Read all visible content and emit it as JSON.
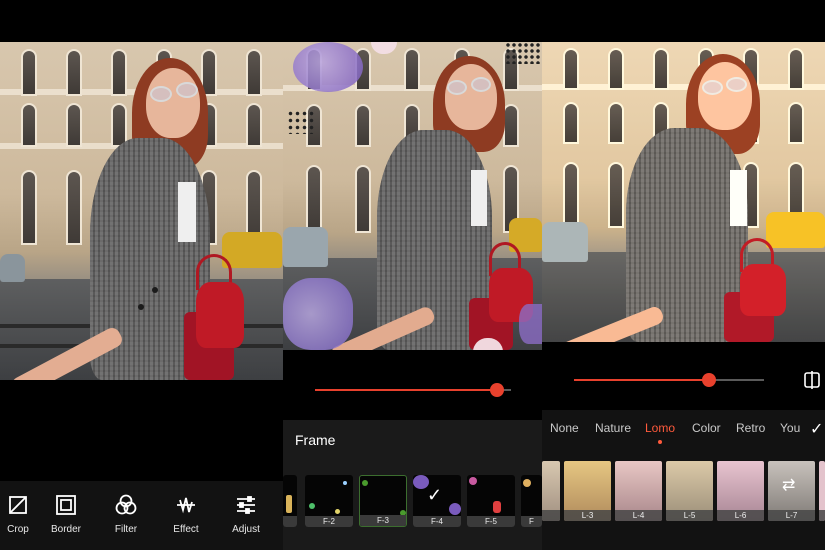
{
  "screens": {
    "edit": {
      "toolbar": [
        {
          "label": "Crop",
          "icon": "crop-icon"
        },
        {
          "label": "Border",
          "icon": "border-icon"
        },
        {
          "label": "Filter",
          "icon": "filter-icon"
        },
        {
          "label": "Effect",
          "icon": "effect-icon"
        },
        {
          "label": "Adjust",
          "icon": "adjust-icon"
        }
      ]
    },
    "frame": {
      "title": "Frame",
      "slider_value": 0.93,
      "frames": [
        "",
        "F-2",
        "F-3",
        "F-4",
        "F-5",
        "F"
      ],
      "selected": "F-4"
    },
    "filter": {
      "slider_value": 0.71,
      "tabs": [
        "None",
        "Nature",
        "Lomo",
        "Color",
        "Retro",
        "You"
      ],
      "active_tab": "Lomo",
      "presets": [
        "",
        "L-3",
        "L-4",
        "L-5",
        "L-6",
        "L-7",
        ""
      ],
      "confirm_icon": "checkmark-icon",
      "compare_icon": "compare-icon"
    }
  },
  "colors": {
    "accent": "#e8412d",
    "tab_active": "#ff5a3c",
    "toolbar_bg": "#121212",
    "frame_panel_bg": "#1a1a1a"
  }
}
